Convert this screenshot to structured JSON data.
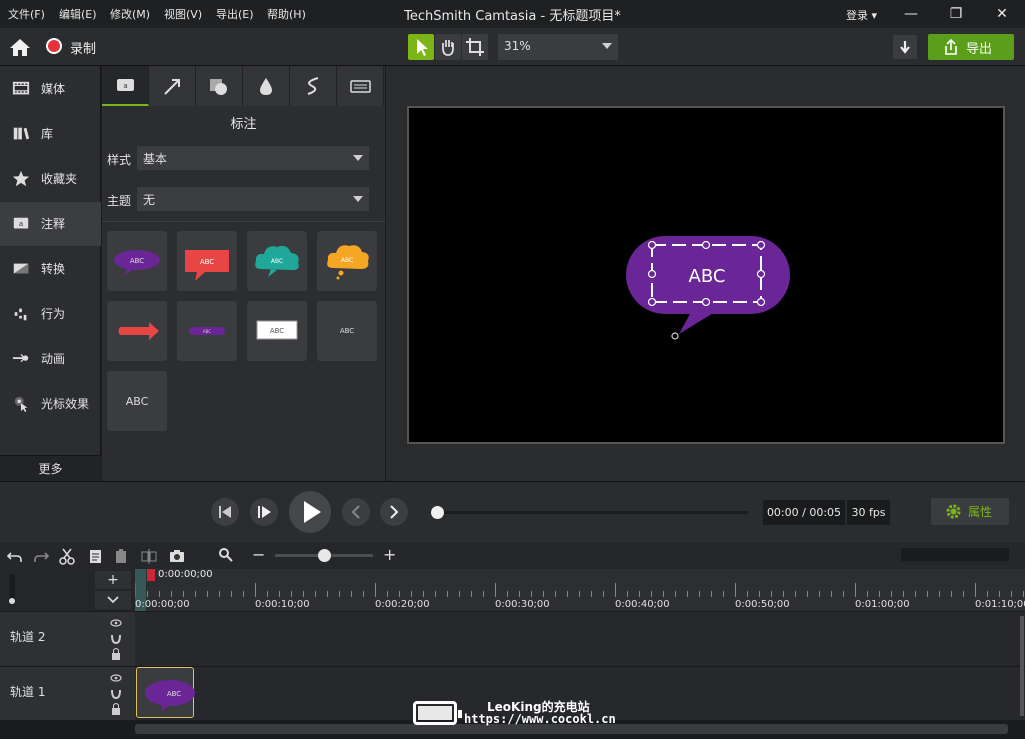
{
  "window": {
    "title": "TechSmith Camtasia - 无标题项目*",
    "menu": [
      "文件(F)",
      "编辑(E)",
      "修改(M)",
      "视图(V)",
      "导出(E)",
      "帮助(H)"
    ],
    "login_label": "登录"
  },
  "toolbar": {
    "record_label": "录制",
    "zoom_value": "31%",
    "export_label": "导出"
  },
  "sidebar": {
    "items": [
      {
        "label": "媒体",
        "icon": "film-icon"
      },
      {
        "label": "库",
        "icon": "library-icon"
      },
      {
        "label": "收藏夹",
        "icon": "star-icon"
      },
      {
        "label": "注释",
        "icon": "annotation-icon",
        "active": true
      },
      {
        "label": "转换",
        "icon": "transition-icon"
      },
      {
        "label": "行为",
        "icon": "behavior-icon"
      },
      {
        "label": "动画",
        "icon": "animation-icon"
      },
      {
        "label": "光标效果",
        "icon": "cursor-effect-icon"
      }
    ],
    "more_label": "更多"
  },
  "panel": {
    "tabs": [
      "callout-tab",
      "arrow-tab",
      "shape-tab",
      "blur-tab",
      "sketch-tab",
      "keystroke-tab"
    ],
    "title": "标注",
    "style_label": "样式",
    "style_value": "基本",
    "theme_label": "主题",
    "theme_value": "无",
    "tiles": [
      {
        "text": "ABC",
        "kind": "bubble-purple"
      },
      {
        "text": "ABC",
        "kind": "speech-red"
      },
      {
        "text": "ABC",
        "kind": "cloud-teal"
      },
      {
        "text": "ABC",
        "kind": "thought-yellow"
      },
      {
        "text": "",
        "kind": "arrow-red"
      },
      {
        "text": "ABC",
        "kind": "pill-purple"
      },
      {
        "text": "ABC",
        "kind": "box-white"
      },
      {
        "text": "ABC",
        "kind": "text-only"
      },
      {
        "text": "ABC",
        "kind": "text-large"
      }
    ]
  },
  "canvas": {
    "callout_text": "ABC",
    "callout_color": "#6a2596"
  },
  "playback": {
    "time": "00:00 / 00:05",
    "fps": "30 fps",
    "properties_label": "属性"
  },
  "timeline": {
    "playhead_time": "0:00:00;00",
    "ticks": [
      "0:00:00;00",
      "0:00:10;00",
      "0:00:20;00",
      "0:00:30;00",
      "0:00:40;00",
      "0:00:50;00",
      "0:01:00;00",
      "0:01:10;00"
    ],
    "tracks": [
      {
        "label": "轨道 2"
      },
      {
        "label": "轨道 1",
        "clip_text": "ABC"
      }
    ]
  },
  "watermark": {
    "line1": "LeoKing的充电站",
    "line2": "https://www.cocokl.cn"
  },
  "colors": {
    "accent_green": "#7cb518",
    "export_green": "#5a9e1a",
    "record_red": "#e8303a"
  }
}
